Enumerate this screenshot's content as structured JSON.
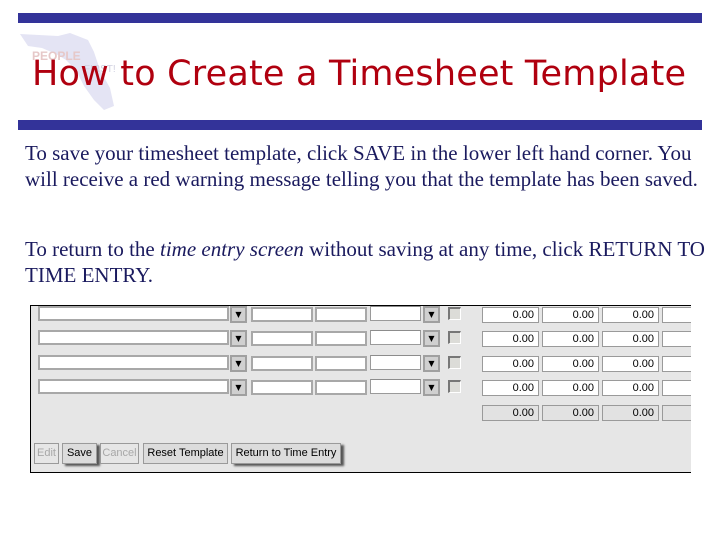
{
  "slide": {
    "title": "How to Create a Timesheet Template",
    "logo": {
      "word1": "PEOPLE",
      "word2": "FIRST!"
    },
    "paragraphs": {
      "p1": "To save your timesheet template, click SAVE in the lower left hand corner.  You will receive a red warning message telling you that the template has been saved.",
      "p2_before": "To return to the ",
      "p2_italic": "time entry screen",
      "p2_after": " without saving at any time, click RETURN TO TIME ENTRY."
    },
    "colors": {
      "bar": "#333399",
      "title": "#B0000F",
      "body_text": "#1A1A5E"
    }
  },
  "timesheet": {
    "rows": [
      {
        "totals": [
          "0.00",
          "0.00",
          "0.00",
          ""
        ]
      },
      {
        "totals": [
          "0.00",
          "0.00",
          "0.00",
          ""
        ]
      },
      {
        "totals": [
          "0.00",
          "0.00",
          "0.00",
          ""
        ]
      },
      {
        "totals": [
          "0.00",
          "0.00",
          "0.00",
          ""
        ]
      }
    ],
    "summary_row": [
      "0.00",
      "0.00",
      "0.00",
      ""
    ],
    "buttons": {
      "edit": "Edit",
      "save": "Save",
      "cancel": "Cancel",
      "reset_template": "Reset Template",
      "return_to_time_entry": "Return to Time Entry"
    }
  }
}
